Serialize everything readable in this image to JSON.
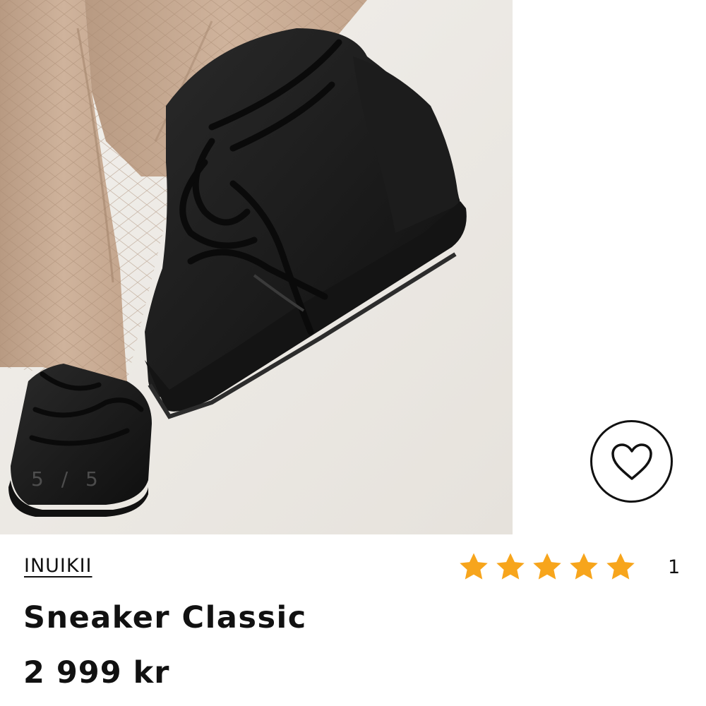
{
  "gallery": {
    "counter": "5 / 5",
    "image_alt": "Black lace-up sneaker boot with rope laces worn with beige croc-textured trousers"
  },
  "wishlist": {
    "icon": "heart-outline-icon"
  },
  "product": {
    "brand": "INUIKII",
    "name": "Sneaker Classic",
    "price": "2 999 kr",
    "rating": {
      "value": 5,
      "max": 5,
      "count": "1",
      "star_color": "#f7a51c"
    }
  }
}
